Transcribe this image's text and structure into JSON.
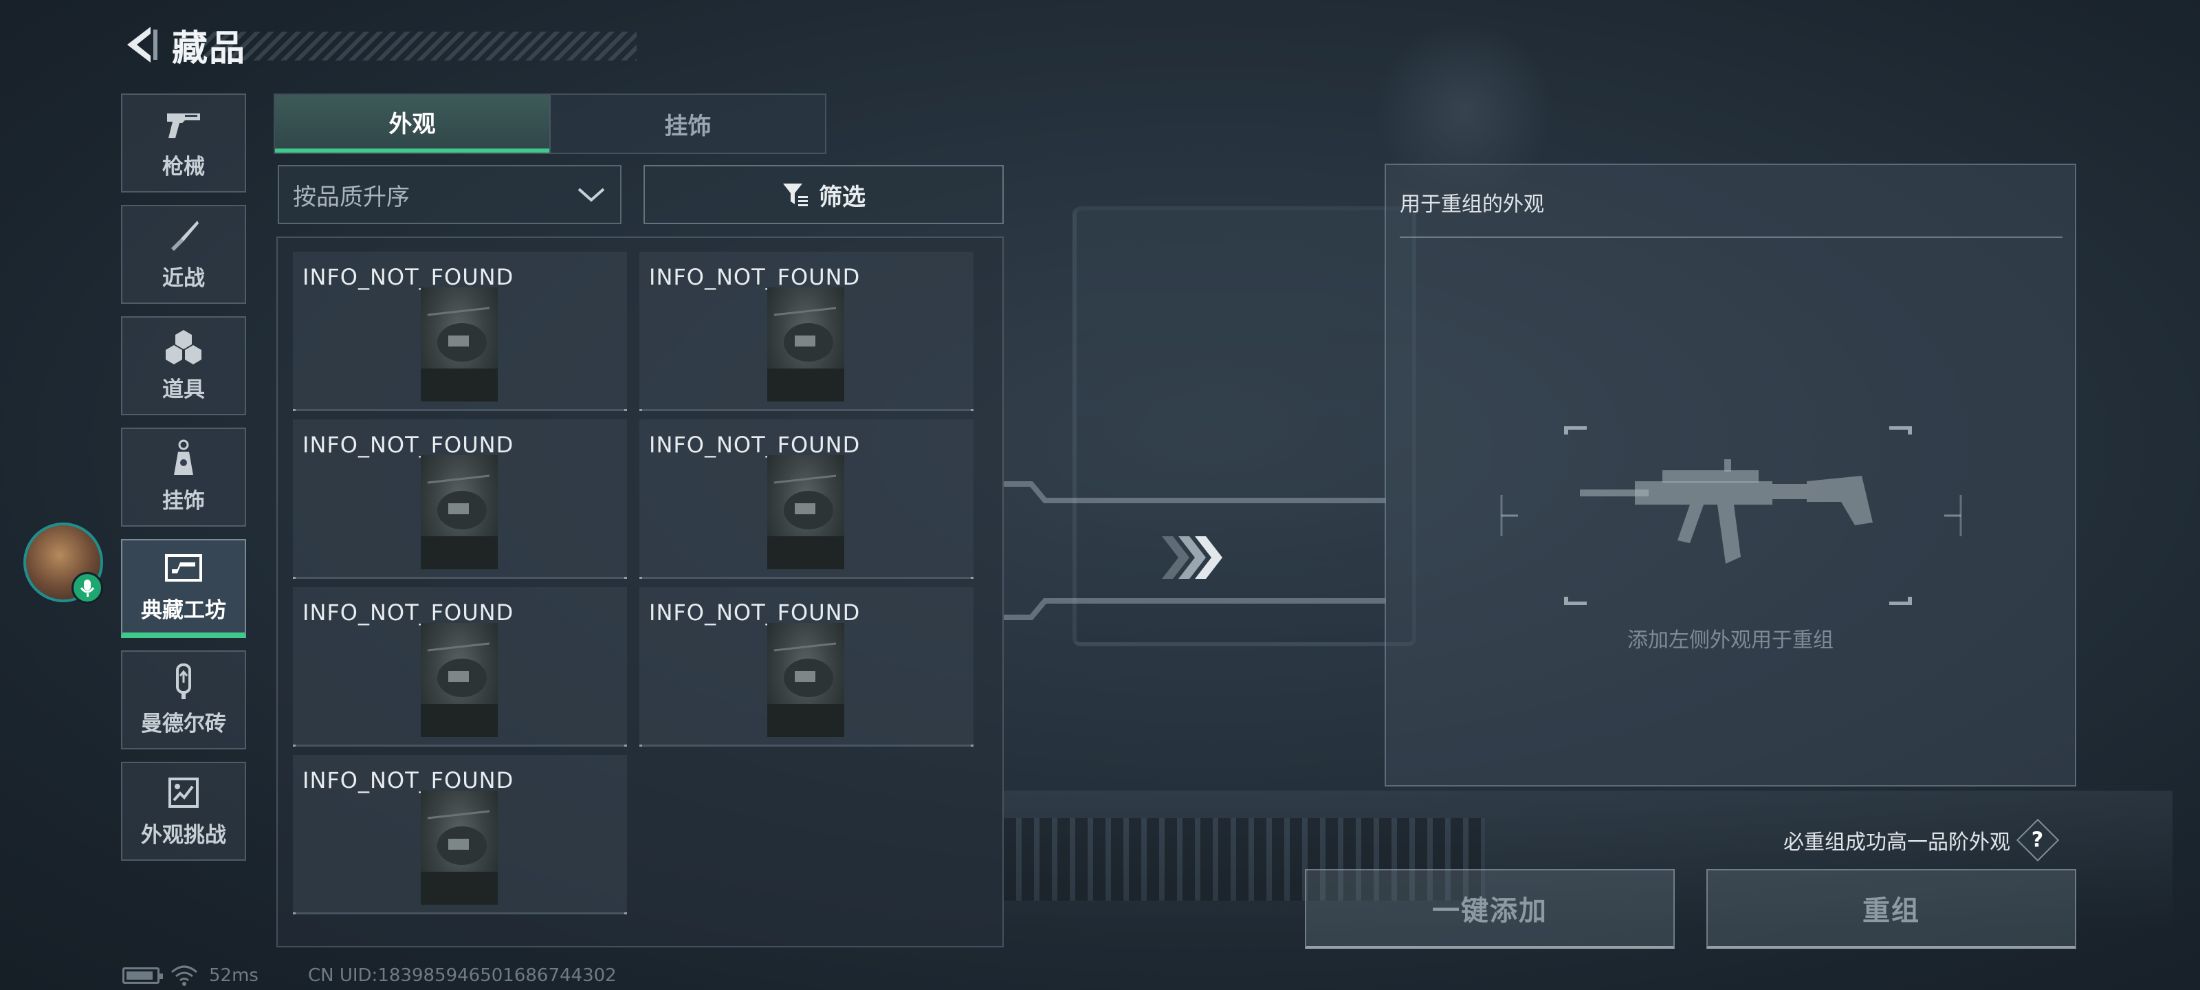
{
  "header": {
    "title": "藏品"
  },
  "nav": {
    "items": [
      {
        "label": "枪械",
        "icon": "pistol-icon",
        "active": false
      },
      {
        "label": "近战",
        "icon": "knife-icon",
        "active": false
      },
      {
        "label": "道具",
        "icon": "grenades-icon",
        "active": false
      },
      {
        "label": "挂饰",
        "icon": "charm-icon",
        "active": false
      },
      {
        "label": "典藏工坊",
        "icon": "workshop-icon",
        "active": true
      },
      {
        "label": "曼德尔砖",
        "icon": "mandel-brick-icon",
        "active": false
      },
      {
        "label": "外观挑战",
        "icon": "skin-challenge-icon",
        "active": false
      }
    ]
  },
  "tabs": [
    {
      "label": "外观",
      "active": true
    },
    {
      "label": "挂饰",
      "active": false
    }
  ],
  "sort": {
    "label": "按品质升序"
  },
  "filter": {
    "label": "筛选"
  },
  "items": [
    {
      "name": "INFO_NOT_FOUND"
    },
    {
      "name": "INFO_NOT_FOUND"
    },
    {
      "name": "INFO_NOT_FOUND"
    },
    {
      "name": "INFO_NOT_FOUND"
    },
    {
      "name": "INFO_NOT_FOUND"
    },
    {
      "name": "INFO_NOT_FOUND"
    },
    {
      "name": "INFO_NOT_FOUND"
    }
  ],
  "recombine_panel": {
    "title": "用于重组的外观",
    "hint": "添加左侧外观用于重组"
  },
  "guarantee_text": "必重组成功高一品阶外观",
  "help_label": "?",
  "buttons": {
    "quick_add": "一键添加",
    "recombine": "重组"
  },
  "status": {
    "ping": "52ms",
    "uid": "CN UID:1839859465016867443​02"
  },
  "colors": {
    "accent": "#3fc98a",
    "mic_badge": "#1fa772",
    "avatar_ring": "#1f8f8e"
  }
}
